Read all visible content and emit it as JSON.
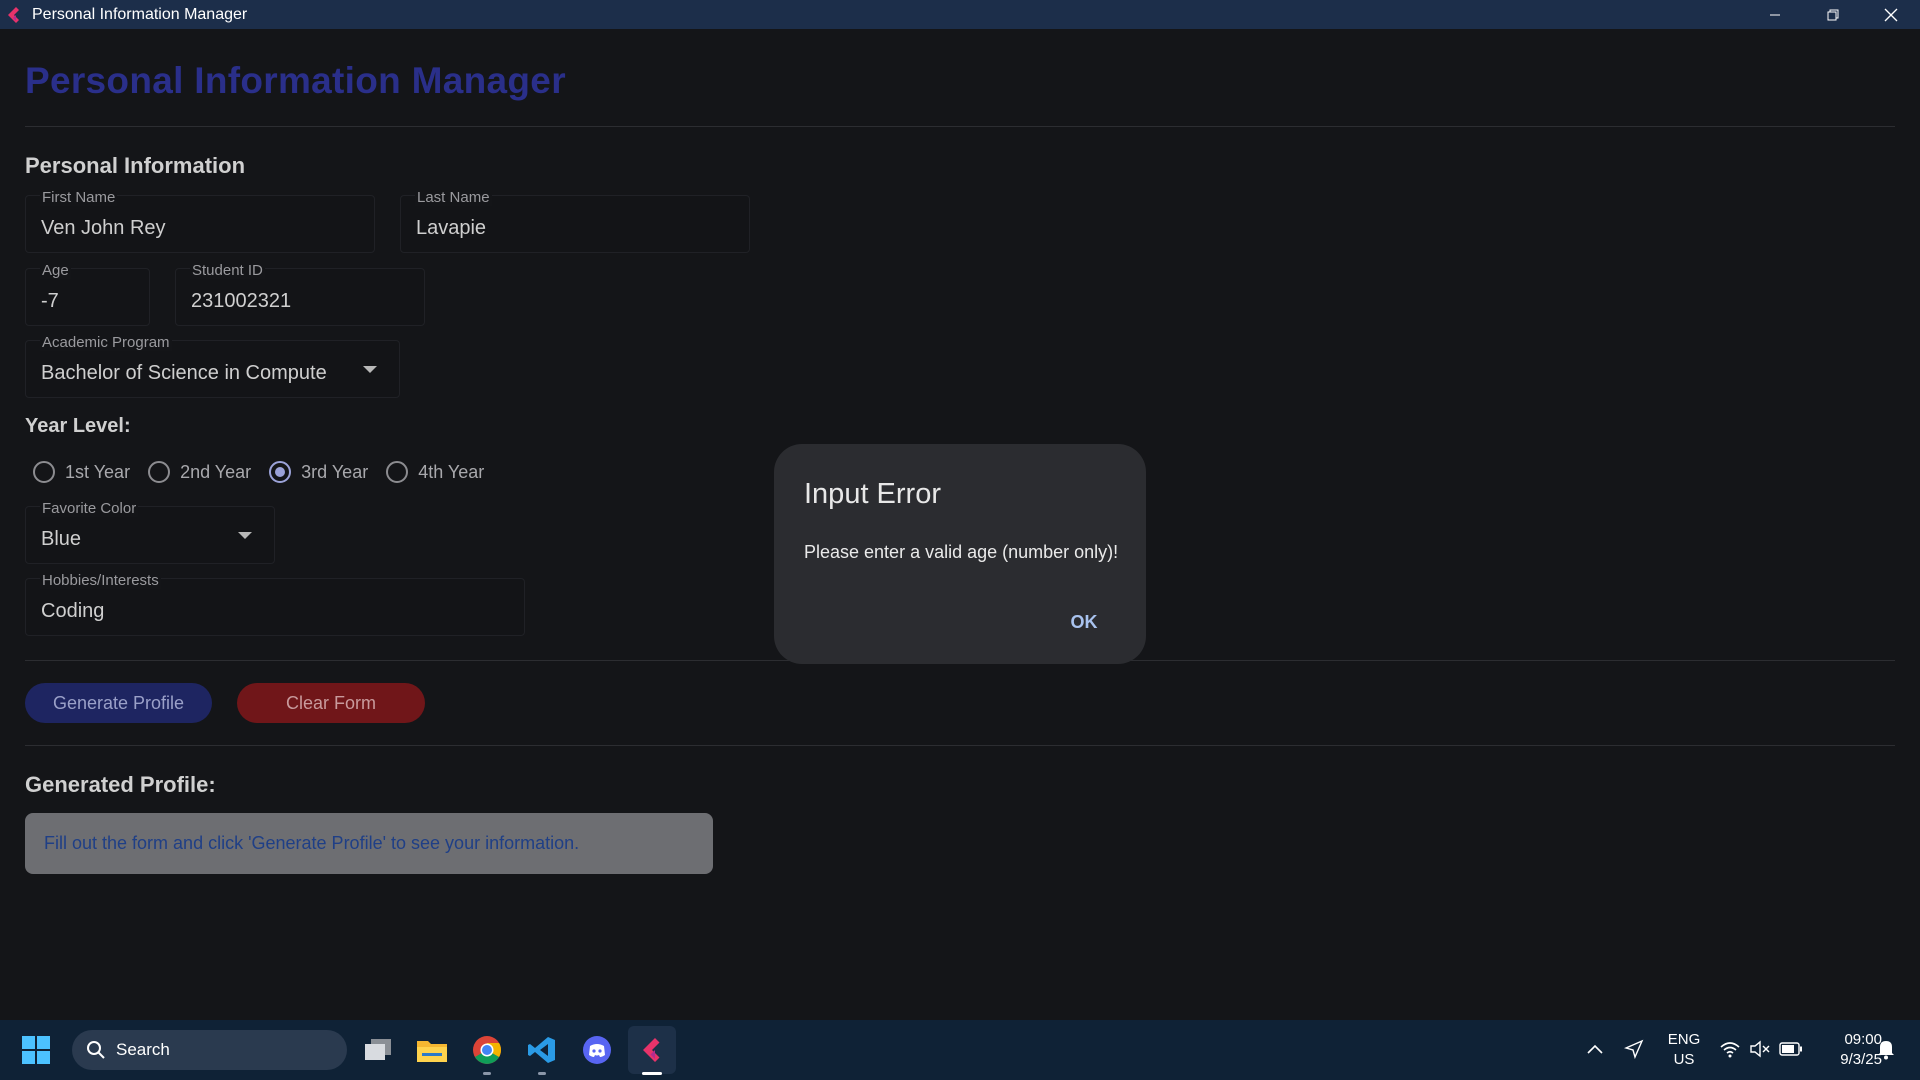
{
  "window": {
    "title": "Personal Information Manager",
    "controls": {
      "minimize": "minimize-icon",
      "maximize": "restore-icon",
      "close": "close-icon"
    }
  },
  "app": {
    "heading": "Personal Information Manager",
    "personal_section_title": "Personal Information",
    "fields": {
      "first_name": {
        "label": "First Name",
        "value": "Ven John Rey"
      },
      "last_name": {
        "label": "Last Name",
        "value": "Lavapie"
      },
      "age": {
        "label": "Age",
        "value": "-7"
      },
      "student_id": {
        "label": "Student ID",
        "value": "231002321"
      },
      "academic_program": {
        "label": "Academic Program",
        "value": "Bachelor of Science in Compute"
      },
      "favorite_color": {
        "label": "Favorite Color",
        "value": "Blue"
      },
      "hobbies": {
        "label": "Hobbies/Interests",
        "value": "Coding"
      }
    },
    "year_level": {
      "title": "Year Level:",
      "options": [
        "1st Year",
        "2nd Year",
        "3rd Year",
        "4th Year"
      ],
      "selected": "3rd Year"
    },
    "buttons": {
      "generate": "Generate Profile",
      "clear": "Clear Form"
    },
    "generated_title": "Generated Profile:",
    "generated_placeholder": "Fill out the form and click 'Generate Profile' to see your information."
  },
  "dialog": {
    "title": "Input Error",
    "message": "Please enter a valid age (number only)!",
    "ok_label": "OK"
  },
  "taskbar": {
    "search_label": "Search",
    "apps": [
      "windows-start-icon",
      "task-view-icon",
      "file-explorer-icon",
      "chrome-icon",
      "vscode-icon",
      "discord-icon",
      "flutter-app-icon"
    ],
    "language": "ENG",
    "region": "US",
    "time": "09:00",
    "date": "9/3/25"
  },
  "colors": {
    "titlebar": "#1c2e4a",
    "heading": "#2a2f8a",
    "generate_button": "#1e2561",
    "clear_button": "#701619",
    "dialog_bg": "#2b2c30",
    "ok_text": "#a9c3ef",
    "taskbar": "#0f2236"
  }
}
